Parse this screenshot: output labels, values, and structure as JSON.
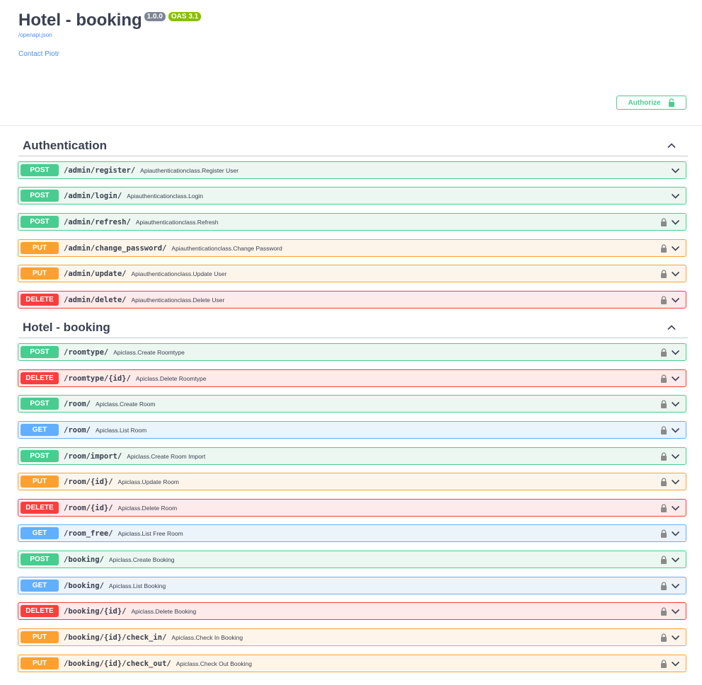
{
  "info": {
    "title": "Hotel - booking",
    "version": "1.0.0",
    "oas": "OAS 3.1",
    "spec_link": "/openapi.json",
    "contact": "Contact Piotr"
  },
  "authorize_label": "Authorize",
  "colors": {
    "post": "#49cc90",
    "put": "#fca130",
    "delete": "#f93e3e",
    "get": "#61affe"
  },
  "sections": [
    {
      "name": "Authentication",
      "operations": [
        {
          "method": "POST",
          "path": "/admin/register/",
          "summary": "Apiauthenticationclass.Register User",
          "locked": false
        },
        {
          "method": "POST",
          "path": "/admin/login/",
          "summary": "Apiauthenticationclass.Login",
          "locked": false
        },
        {
          "method": "POST",
          "path": "/admin/refresh/",
          "summary": "Apiauthenticationclass.Refresh",
          "locked": true
        },
        {
          "method": "PUT",
          "path": "/admin/change_password/",
          "summary": "Apiauthenticationclass.Change Password",
          "locked": true
        },
        {
          "method": "PUT",
          "path": "/admin/update/",
          "summary": "Apiauthenticationclass.Update User",
          "locked": true
        },
        {
          "method": "DELETE",
          "path": "/admin/delete/",
          "summary": "Apiauthenticationclass.Delete User",
          "locked": true
        }
      ]
    },
    {
      "name": "Hotel - booking",
      "operations": [
        {
          "method": "POST",
          "path": "/roomtype/",
          "summary": "Apiclass.Create Roomtype",
          "locked": true
        },
        {
          "method": "DELETE",
          "path": "/roomtype/{id}/",
          "summary": "Apiclass.Delete Roomtype",
          "locked": true
        },
        {
          "method": "POST",
          "path": "/room/",
          "summary": "Apiclass.Create Room",
          "locked": true
        },
        {
          "method": "GET",
          "path": "/room/",
          "summary": "Apiclass.List Room",
          "locked": true
        },
        {
          "method": "POST",
          "path": "/room/import/",
          "summary": "Apiclass.Create Room Import",
          "locked": true
        },
        {
          "method": "PUT",
          "path": "/room/{id}/",
          "summary": "Apiclass.Update Room",
          "locked": true
        },
        {
          "method": "DELETE",
          "path": "/room/{id}/",
          "summary": "Apiclass.Delete Room",
          "locked": true
        },
        {
          "method": "GET",
          "path": "/room_free/",
          "summary": "Apiclass.List Free Room",
          "locked": true
        },
        {
          "method": "POST",
          "path": "/booking/",
          "summary": "Apiclass.Create Booking",
          "locked": true
        },
        {
          "method": "GET",
          "path": "/booking/",
          "summary": "Apiclass.List Booking",
          "locked": true
        },
        {
          "method": "DELETE",
          "path": "/booking/{id}/",
          "summary": "Apiclass.Delete Booking",
          "locked": true
        },
        {
          "method": "PUT",
          "path": "/booking/{id}/check_in/",
          "summary": "Apiclass.Check In Booking",
          "locked": true
        },
        {
          "method": "PUT",
          "path": "/booking/{id}/check_out/",
          "summary": "Apiclass.Check Out Booking",
          "locked": true
        }
      ]
    }
  ]
}
